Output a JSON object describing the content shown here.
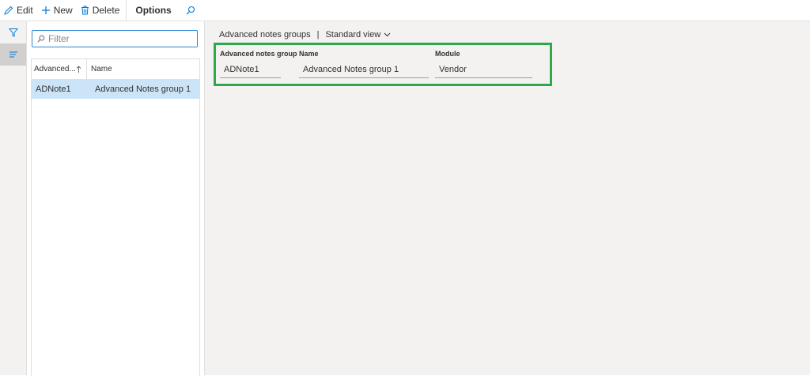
{
  "toolbar": {
    "edit_label": "Edit",
    "new_label": "New",
    "delete_label": "Delete",
    "options_label": "Options"
  },
  "filter": {
    "placeholder": "Filter"
  },
  "grid": {
    "columns": [
      "Advanced...",
      "Name"
    ],
    "rows": [
      {
        "id": "ADNote1",
        "name": "Advanced Notes group 1"
      }
    ]
  },
  "breadcrumb": {
    "title": "Advanced notes groups",
    "separator": "|",
    "view": "Standard view"
  },
  "details": {
    "group_label": "Advanced notes group",
    "group_value": "ADNote1",
    "name_label": "Name",
    "name_value": "Advanced Notes group 1",
    "module_label": "Module",
    "module_value": "Vendor"
  },
  "colors": {
    "accent": "#2b88d8",
    "highlight_border": "#2ea84b",
    "selected_row": "#cce4f7"
  }
}
